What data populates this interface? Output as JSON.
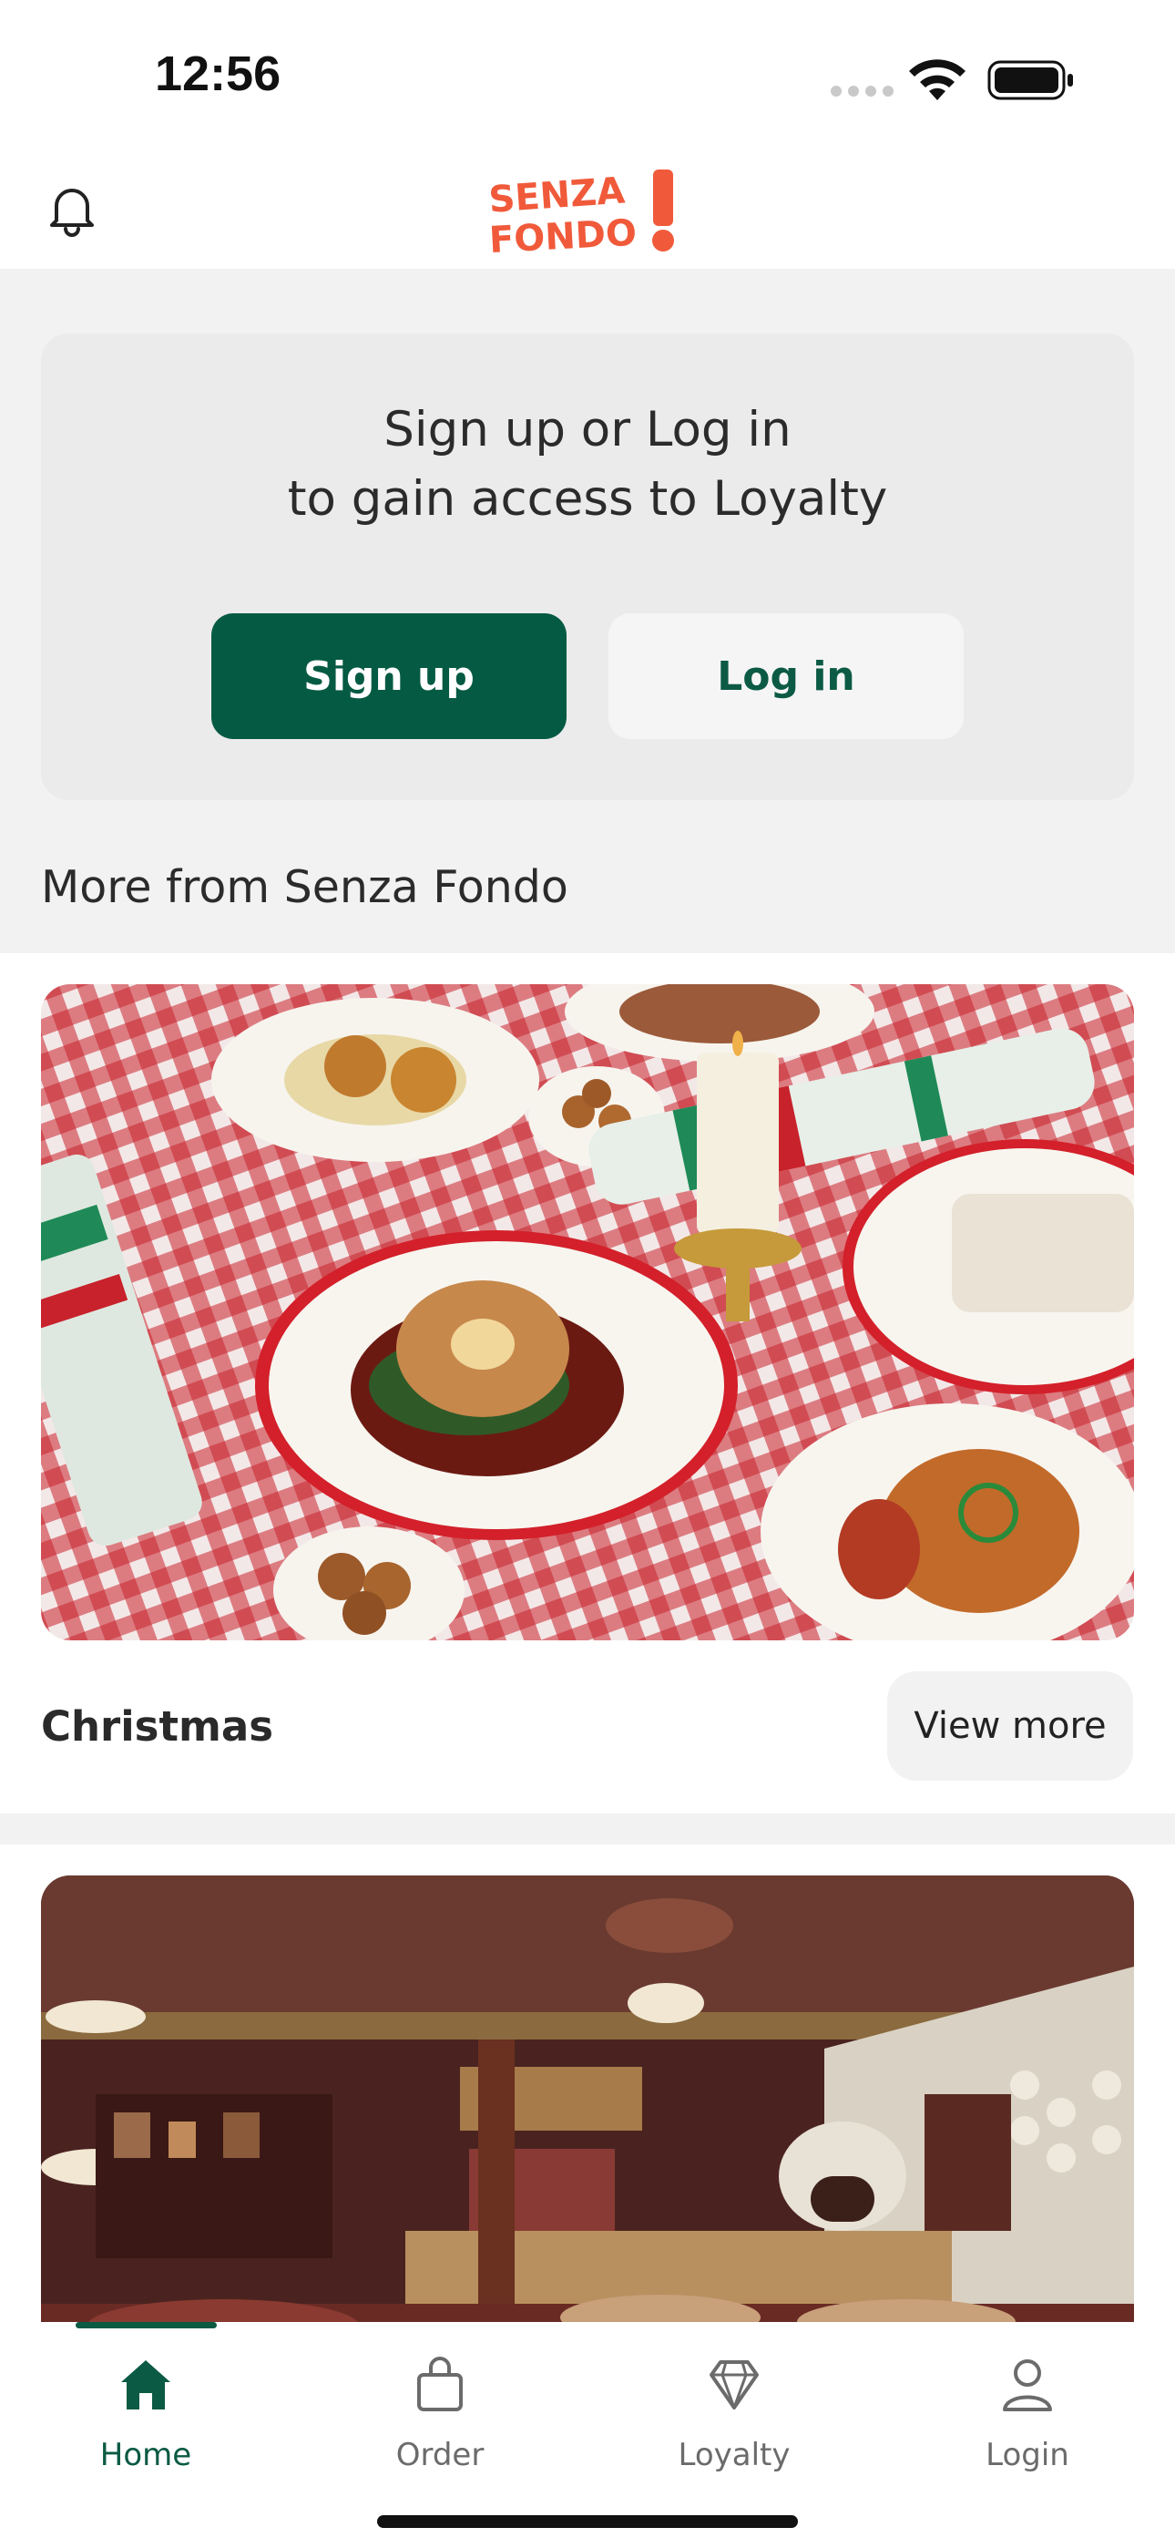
{
  "status_bar": {
    "time": "12:56"
  },
  "header": {
    "logo_alt": "SENZA FONDO!"
  },
  "auth": {
    "line1": "Sign up or Log in",
    "line2": "to gain access to Loyalty",
    "signup_label": "Sign up",
    "login_label": "Log in"
  },
  "section": {
    "title": "More from Senza Fondo"
  },
  "cards": [
    {
      "title": "Christmas",
      "cta": "View more"
    },
    {
      "title": ""
    }
  ],
  "tabs": [
    {
      "label": "Home",
      "icon": "home-icon",
      "active": true
    },
    {
      "label": "Order",
      "icon": "bag-icon"
    },
    {
      "label": "Loyalty",
      "icon": "diamond-icon"
    },
    {
      "label": "Login",
      "icon": "user-icon"
    }
  ],
  "colors": {
    "brand_green": "#055a43",
    "logo_orange": "#f05a3a"
  }
}
